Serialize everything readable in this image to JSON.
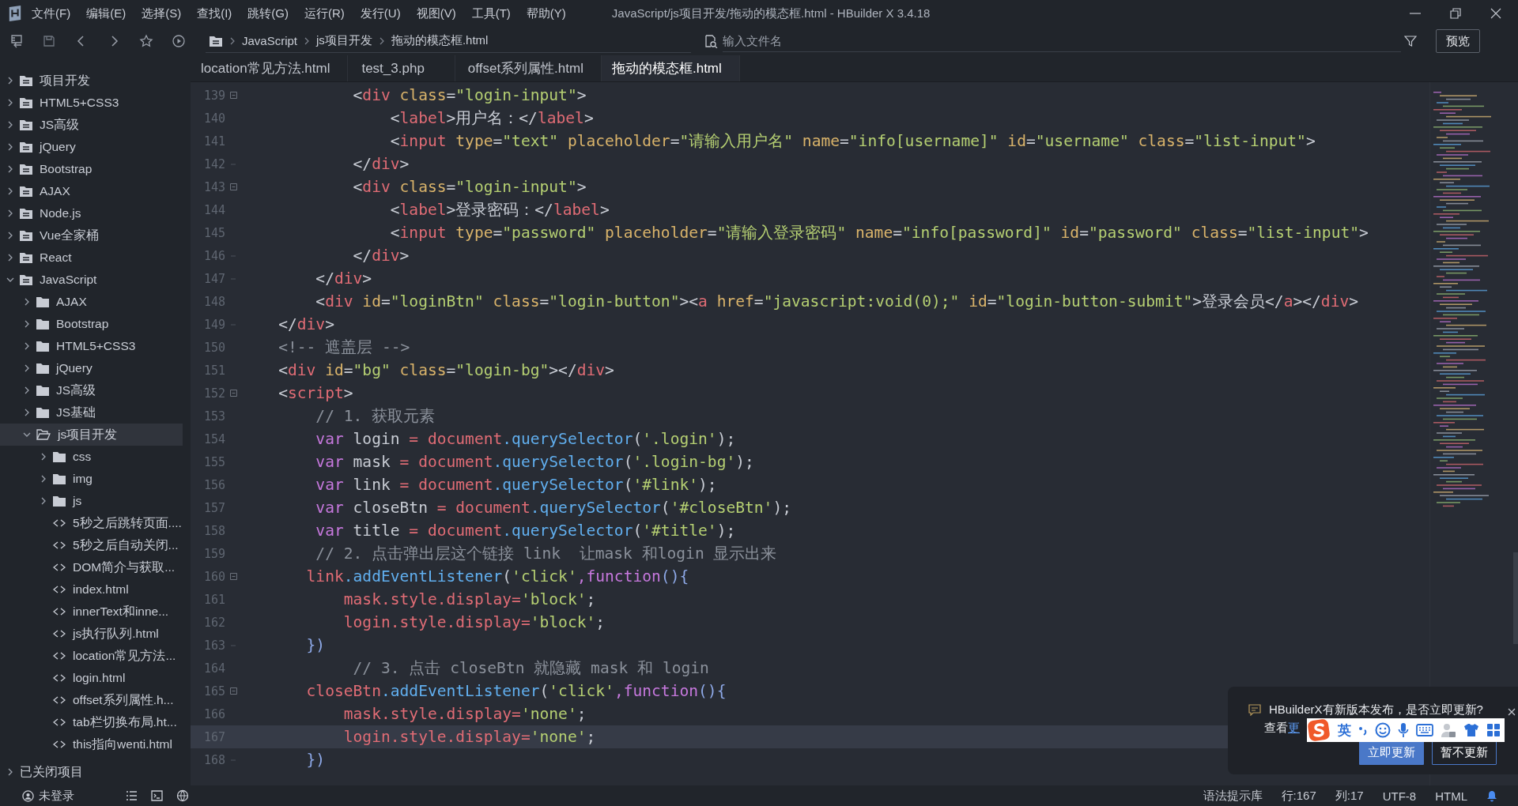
{
  "window": {
    "title": "JavaScript/js项目开发/拖动的模态框.html - HBuilder X 3.4.18"
  },
  "menu": [
    "文件(F)",
    "编辑(E)",
    "选择(S)",
    "查找(I)",
    "跳转(G)",
    "运行(R)",
    "发行(U)",
    "视图(V)",
    "工具(T)",
    "帮助(Y)"
  ],
  "toolbar": {
    "breadcrumb": [
      "JavaScript",
      "js项目开发",
      "拖动的模态框.html"
    ],
    "file_search": {
      "placeholder": "输入文件名"
    },
    "preview_button": "预览"
  },
  "tabs": [
    {
      "label": "location常见方法.html",
      "selected": false
    },
    {
      "label": "test_3.php",
      "selected": false
    },
    {
      "label": "offset系列属性.html",
      "selected": false
    },
    {
      "label": "拖动的模态框.html",
      "selected": true
    }
  ],
  "sidebar": {
    "items": [
      {
        "label": "项目开发",
        "kind": "project",
        "expanded": false,
        "selected": false
      },
      {
        "label": "HTML5+CSS3",
        "kind": "project",
        "expanded": false,
        "selected": false
      },
      {
        "label": "JS高级",
        "kind": "project",
        "expanded": false,
        "selected": false
      },
      {
        "label": "jQuery",
        "kind": "project",
        "expanded": false,
        "selected": false
      },
      {
        "label": "Bootstrap",
        "kind": "project",
        "expanded": false,
        "selected": false
      },
      {
        "label": "AJAX",
        "kind": "project",
        "expanded": false,
        "selected": false
      },
      {
        "label": "Node.js",
        "kind": "project",
        "expanded": false,
        "selected": false
      },
      {
        "label": "Vue全家桶",
        "kind": "project",
        "expanded": false,
        "selected": false
      },
      {
        "label": "React",
        "kind": "project",
        "expanded": false,
        "selected": false
      },
      {
        "label": "JavaScript",
        "kind": "project",
        "expanded": true,
        "selected": false,
        "children": [
          {
            "label": "AJAX",
            "kind": "folder",
            "expanded": false,
            "selected": false
          },
          {
            "label": "Bootstrap",
            "kind": "folder",
            "expanded": false,
            "selected": false
          },
          {
            "label": "HTML5+CSS3",
            "kind": "folder",
            "expanded": false,
            "selected": false
          },
          {
            "label": "jQuery",
            "kind": "folder",
            "expanded": false,
            "selected": false
          },
          {
            "label": "JS高级",
            "kind": "folder",
            "expanded": false,
            "selected": false
          },
          {
            "label": "JS基础",
            "kind": "folder",
            "expanded": false,
            "selected": false
          },
          {
            "label": "js项目开发",
            "kind": "folder",
            "expanded": true,
            "selected": true,
            "children": [
              {
                "label": "css",
                "kind": "folder",
                "expanded": false,
                "selected": false
              },
              {
                "label": "img",
                "kind": "folder",
                "expanded": false,
                "selected": false
              },
              {
                "label": "js",
                "kind": "folder",
                "expanded": false,
                "selected": false
              },
              {
                "label": "5秒之后跳转页面....",
                "kind": "file",
                "selected": false
              },
              {
                "label": "5秒之后自动关闭...",
                "kind": "file",
                "selected": false
              },
              {
                "label": "DOM简介与获取...",
                "kind": "file",
                "selected": false
              },
              {
                "label": "index.html",
                "kind": "file",
                "selected": false
              },
              {
                "label": "innerText和inne...",
                "kind": "file",
                "selected": false
              },
              {
                "label": "js执行队列.html",
                "kind": "file",
                "selected": false
              },
              {
                "label": "location常见方法...",
                "kind": "file",
                "selected": false
              },
              {
                "label": "login.html",
                "kind": "file",
                "selected": false
              },
              {
                "label": "offset系列属性.h...",
                "kind": "file",
                "selected": false
              },
              {
                "label": "tab栏切换布局.ht...",
                "kind": "file",
                "selected": false
              },
              {
                "label": "this指向wenti.html",
                "kind": "file",
                "selected": false
              }
            ]
          }
        ]
      }
    ],
    "closed_projects": {
      "label": "已关闭项目",
      "expanded": false
    }
  },
  "editor": {
    "lines": [
      {
        "number": "139",
        "fold_start": true,
        "fold_end": false,
        "current": false,
        "tokens": [
          {
            "kind": "plain",
            "text": "            <"
          },
          {
            "kind": "tag",
            "text": "div"
          },
          {
            "kind": "attr",
            "text": " class"
          },
          {
            "kind": "plain",
            "text": "="
          },
          {
            "kind": "str",
            "text": "\"login-input\""
          },
          {
            "kind": "plain",
            "text": ">"
          }
        ]
      },
      {
        "number": "140",
        "fold_start": false,
        "fold_end": false,
        "current": false,
        "tokens": [
          {
            "kind": "plain",
            "text": "                <"
          },
          {
            "kind": "tag",
            "text": "label"
          },
          {
            "kind": "plain",
            "text": ">用户名：</"
          },
          {
            "kind": "tag",
            "text": "label"
          },
          {
            "kind": "plain",
            "text": ">"
          }
        ]
      },
      {
        "number": "141",
        "fold_start": false,
        "fold_end": false,
        "current": false,
        "tokens": [
          {
            "kind": "plain",
            "text": "                <"
          },
          {
            "kind": "tag",
            "text": "input"
          },
          {
            "kind": "attr",
            "text": " type"
          },
          {
            "kind": "plain",
            "text": "="
          },
          {
            "kind": "str",
            "text": "\"text\""
          },
          {
            "kind": "attr",
            "text": " placeholder"
          },
          {
            "kind": "plain",
            "text": "="
          },
          {
            "kind": "str",
            "text": "\"请输入用户名\""
          },
          {
            "kind": "attr",
            "text": " name"
          },
          {
            "kind": "plain",
            "text": "="
          },
          {
            "kind": "str",
            "text": "\"info[username]\""
          },
          {
            "kind": "attr",
            "text": " id"
          },
          {
            "kind": "plain",
            "text": "="
          },
          {
            "kind": "str",
            "text": "\"username\""
          },
          {
            "kind": "attr",
            "text": " class"
          },
          {
            "kind": "plain",
            "text": "="
          },
          {
            "kind": "str",
            "text": "\"list-input\""
          },
          {
            "kind": "plain",
            "text": ">"
          }
        ]
      },
      {
        "number": "142",
        "fold_start": false,
        "fold_end": true,
        "current": false,
        "tokens": [
          {
            "kind": "plain",
            "text": "            </"
          },
          {
            "kind": "tag",
            "text": "div"
          },
          {
            "kind": "plain",
            "text": ">"
          }
        ]
      },
      {
        "number": "143",
        "fold_start": true,
        "fold_end": false,
        "current": false,
        "tokens": [
          {
            "kind": "plain",
            "text": "            <"
          },
          {
            "kind": "tag",
            "text": "div"
          },
          {
            "kind": "attr",
            "text": " class"
          },
          {
            "kind": "plain",
            "text": "="
          },
          {
            "kind": "str",
            "text": "\"login-input\""
          },
          {
            "kind": "plain",
            "text": ">"
          }
        ]
      },
      {
        "number": "144",
        "fold_start": false,
        "fold_end": false,
        "current": false,
        "tokens": [
          {
            "kind": "plain",
            "text": "                <"
          },
          {
            "kind": "tag",
            "text": "label"
          },
          {
            "kind": "plain",
            "text": ">登录密码：</"
          },
          {
            "kind": "tag",
            "text": "label"
          },
          {
            "kind": "plain",
            "text": ">"
          }
        ]
      },
      {
        "number": "145",
        "fold_start": false,
        "fold_end": false,
        "current": false,
        "tokens": [
          {
            "kind": "plain",
            "text": "                <"
          },
          {
            "kind": "tag",
            "text": "input"
          },
          {
            "kind": "attr",
            "text": " type"
          },
          {
            "kind": "plain",
            "text": "="
          },
          {
            "kind": "str",
            "text": "\"password\""
          },
          {
            "kind": "attr",
            "text": " placeholder"
          },
          {
            "kind": "plain",
            "text": "="
          },
          {
            "kind": "str",
            "text": "\"请输入登录密码\""
          },
          {
            "kind": "attr",
            "text": " name"
          },
          {
            "kind": "plain",
            "text": "="
          },
          {
            "kind": "str",
            "text": "\"info[password]\""
          },
          {
            "kind": "attr",
            "text": " id"
          },
          {
            "kind": "plain",
            "text": "="
          },
          {
            "kind": "str",
            "text": "\"password\""
          },
          {
            "kind": "attr",
            "text": " class"
          },
          {
            "kind": "plain",
            "text": "="
          },
          {
            "kind": "str",
            "text": "\"list-input\""
          },
          {
            "kind": "plain",
            "text": ">"
          }
        ]
      },
      {
        "number": "146",
        "fold_start": false,
        "fold_end": true,
        "current": false,
        "tokens": [
          {
            "kind": "plain",
            "text": "            </"
          },
          {
            "kind": "tag",
            "text": "div"
          },
          {
            "kind": "plain",
            "text": ">"
          }
        ]
      },
      {
        "number": "147",
        "fold_start": false,
        "fold_end": true,
        "current": false,
        "tokens": [
          {
            "kind": "plain",
            "text": "        </"
          },
          {
            "kind": "tag",
            "text": "div"
          },
          {
            "kind": "plain",
            "text": ">"
          }
        ]
      },
      {
        "number": "148",
        "fold_start": false,
        "fold_end": false,
        "current": false,
        "tokens": [
          {
            "kind": "plain",
            "text": "        <"
          },
          {
            "kind": "tag",
            "text": "div"
          },
          {
            "kind": "attr",
            "text": " id"
          },
          {
            "kind": "plain",
            "text": "="
          },
          {
            "kind": "str",
            "text": "\"loginBtn\""
          },
          {
            "kind": "attr",
            "text": " class"
          },
          {
            "kind": "plain",
            "text": "="
          },
          {
            "kind": "str",
            "text": "\"login-button\""
          },
          {
            "kind": "plain",
            "text": "><"
          },
          {
            "kind": "tag",
            "text": "a"
          },
          {
            "kind": "attr",
            "text": " href"
          },
          {
            "kind": "plain",
            "text": "="
          },
          {
            "kind": "str",
            "text": "\"javascript:void(0);\""
          },
          {
            "kind": "attr",
            "text": " id"
          },
          {
            "kind": "plain",
            "text": "="
          },
          {
            "kind": "str",
            "text": "\"login-button-submit\""
          },
          {
            "kind": "plain",
            "text": ">登录会员</"
          },
          {
            "kind": "tag",
            "text": "a"
          },
          {
            "kind": "plain",
            "text": "></"
          },
          {
            "kind": "tag",
            "text": "div"
          },
          {
            "kind": "plain",
            "text": ">"
          }
        ]
      },
      {
        "number": "149",
        "fold_start": false,
        "fold_end": true,
        "current": false,
        "tokens": [
          {
            "kind": "plain",
            "text": "    </"
          },
          {
            "kind": "tag",
            "text": "div"
          },
          {
            "kind": "plain",
            "text": ">"
          }
        ]
      },
      {
        "number": "150",
        "fold_start": false,
        "fold_end": false,
        "current": false,
        "tokens": [
          {
            "kind": "comment",
            "text": "    <!-- 遮盖层 -->"
          }
        ]
      },
      {
        "number": "151",
        "fold_start": false,
        "fold_end": false,
        "current": false,
        "tokens": [
          {
            "kind": "plain",
            "text": "    <"
          },
          {
            "kind": "tag",
            "text": "div"
          },
          {
            "kind": "attr",
            "text": " id"
          },
          {
            "kind": "plain",
            "text": "="
          },
          {
            "kind": "str",
            "text": "\"bg\""
          },
          {
            "kind": "attr",
            "text": " class"
          },
          {
            "kind": "plain",
            "text": "="
          },
          {
            "kind": "str",
            "text": "\"login-bg\""
          },
          {
            "kind": "plain",
            "text": "></"
          },
          {
            "kind": "tag",
            "text": "div"
          },
          {
            "kind": "plain",
            "text": ">"
          }
        ]
      },
      {
        "number": "152",
        "fold_start": true,
        "fold_end": false,
        "current": false,
        "tokens": [
          {
            "kind": "plain",
            "text": "    <"
          },
          {
            "kind": "tag",
            "text": "script"
          },
          {
            "kind": "plain",
            "text": ">"
          }
        ]
      },
      {
        "number": "153",
        "fold_start": false,
        "fold_end": false,
        "current": false,
        "tokens": [
          {
            "kind": "comment",
            "text": "        // 1. 获取元素"
          }
        ]
      },
      {
        "number": "154",
        "fold_start": false,
        "fold_end": false,
        "current": false,
        "tokens": [
          {
            "kind": "kw",
            "text": "        var"
          },
          {
            "kind": "plain",
            "text": " login "
          },
          {
            "kind": "op",
            "text": "="
          },
          {
            "kind": "obj",
            "text": " document"
          },
          {
            "kind": "fn",
            "text": ".querySelector"
          },
          {
            "kind": "plain",
            "text": "("
          },
          {
            "kind": "str",
            "text": "'.login'"
          },
          {
            "kind": "plain",
            "text": ");"
          }
        ]
      },
      {
        "number": "155",
        "fold_start": false,
        "fold_end": false,
        "current": false,
        "tokens": [
          {
            "kind": "kw",
            "text": "        var"
          },
          {
            "kind": "plain",
            "text": " mask "
          },
          {
            "kind": "op",
            "text": "="
          },
          {
            "kind": "obj",
            "text": " document"
          },
          {
            "kind": "fn",
            "text": ".querySelector"
          },
          {
            "kind": "plain",
            "text": "("
          },
          {
            "kind": "str",
            "text": "'.login-bg'"
          },
          {
            "kind": "plain",
            "text": ");"
          }
        ]
      },
      {
        "number": "156",
        "fold_start": false,
        "fold_end": false,
        "current": false,
        "tokens": [
          {
            "kind": "kw",
            "text": "        var"
          },
          {
            "kind": "plain",
            "text": " link "
          },
          {
            "kind": "op",
            "text": "="
          },
          {
            "kind": "obj",
            "text": " document"
          },
          {
            "kind": "fn",
            "text": ".querySelector"
          },
          {
            "kind": "plain",
            "text": "("
          },
          {
            "kind": "str",
            "text": "'#link'"
          },
          {
            "kind": "plain",
            "text": ");"
          }
        ]
      },
      {
        "number": "157",
        "fold_start": false,
        "fold_end": false,
        "current": false,
        "tokens": [
          {
            "kind": "kw",
            "text": "        var"
          },
          {
            "kind": "plain",
            "text": " closeBtn "
          },
          {
            "kind": "op",
            "text": "="
          },
          {
            "kind": "obj",
            "text": " document"
          },
          {
            "kind": "fn",
            "text": ".querySelector"
          },
          {
            "kind": "plain",
            "text": "("
          },
          {
            "kind": "str",
            "text": "'#closeBtn'"
          },
          {
            "kind": "plain",
            "text": ");"
          }
        ]
      },
      {
        "number": "158",
        "fold_start": false,
        "fold_end": false,
        "current": false,
        "tokens": [
          {
            "kind": "kw",
            "text": "        var"
          },
          {
            "kind": "plain",
            "text": " title "
          },
          {
            "kind": "op",
            "text": "="
          },
          {
            "kind": "obj",
            "text": " document"
          },
          {
            "kind": "fn",
            "text": ".querySelector"
          },
          {
            "kind": "plain",
            "text": "("
          },
          {
            "kind": "str",
            "text": "'#title'"
          },
          {
            "kind": "plain",
            "text": ");"
          }
        ]
      },
      {
        "number": "159",
        "fold_start": false,
        "fold_end": false,
        "current": false,
        "tokens": [
          {
            "kind": "comment",
            "text": "        // 2. 点击弹出层这个链接 link  让mask 和login 显示出来"
          }
        ]
      },
      {
        "number": "160",
        "fold_start": true,
        "fold_end": false,
        "current": false,
        "tokens": [
          {
            "kind": "obj",
            "text": "       link"
          },
          {
            "kind": "fn",
            "text": ".addEventListener"
          },
          {
            "kind": "plain",
            "text": "("
          },
          {
            "kind": "str",
            "text": "'click'"
          },
          {
            "kind": "kw",
            "text": ",function"
          },
          {
            "kind": "brace",
            "text": "(){"
          }
        ]
      },
      {
        "number": "161",
        "fold_start": false,
        "fold_end": false,
        "current": false,
        "tokens": [
          {
            "kind": "obj",
            "text": "           mask.style.display"
          },
          {
            "kind": "op",
            "text": "="
          },
          {
            "kind": "str",
            "text": "'block'"
          },
          {
            "kind": "plain",
            "text": ";"
          }
        ]
      },
      {
        "number": "162",
        "fold_start": false,
        "fold_end": false,
        "current": false,
        "tokens": [
          {
            "kind": "obj",
            "text": "           login.style.display"
          },
          {
            "kind": "op",
            "text": "="
          },
          {
            "kind": "str",
            "text": "'block'"
          },
          {
            "kind": "plain",
            "text": ";"
          }
        ]
      },
      {
        "number": "163",
        "fold_start": false,
        "fold_end": true,
        "current": false,
        "tokens": [
          {
            "kind": "brace",
            "text": "       })"
          }
        ]
      },
      {
        "number": "164",
        "fold_start": false,
        "fold_end": false,
        "current": false,
        "tokens": [
          {
            "kind": "comment",
            "text": "            // 3. 点击 closeBtn 就隐藏 mask 和 login"
          }
        ]
      },
      {
        "number": "165",
        "fold_start": true,
        "fold_end": false,
        "current": false,
        "tokens": [
          {
            "kind": "obj",
            "text": "       closeBtn"
          },
          {
            "kind": "fn",
            "text": ".addEventListener"
          },
          {
            "kind": "plain",
            "text": "("
          },
          {
            "kind": "str",
            "text": "'click'"
          },
          {
            "kind": "kw",
            "text": ",function"
          },
          {
            "kind": "brace",
            "text": "(){"
          }
        ]
      },
      {
        "number": "166",
        "fold_start": false,
        "fold_end": false,
        "current": false,
        "tokens": [
          {
            "kind": "obj",
            "text": "           mask.style.display"
          },
          {
            "kind": "op",
            "text": "="
          },
          {
            "kind": "str",
            "text": "'none'"
          },
          {
            "kind": "plain",
            "text": ";"
          }
        ]
      },
      {
        "number": "167",
        "fold_start": false,
        "fold_end": false,
        "current": true,
        "tokens": [
          {
            "kind": "obj",
            "text": "           login.style.display"
          },
          {
            "kind": "op",
            "text": "="
          },
          {
            "kind": "str",
            "text": "'none'"
          },
          {
            "kind": "plain",
            "text": ";"
          }
        ]
      },
      {
        "number": "168",
        "fold_start": false,
        "fold_end": true,
        "current": false,
        "tokens": [
          {
            "kind": "brace",
            "text": "       })"
          }
        ]
      }
    ]
  },
  "notification": {
    "message": "HBuilderX有新版本发布，是否立即更新?",
    "prefix": "查看",
    "link": "更",
    "buttons": [
      {
        "label": "立即更新",
        "kind": "primary"
      },
      {
        "label": "暂不更新",
        "kind": "secondary"
      }
    ]
  },
  "ime_toolbar": {
    "mode": "英"
  },
  "status_bar": {
    "user": "未登录",
    "syntax": "语法提示库",
    "line": "行:167",
    "column": "列:17",
    "encoding": "UTF-8",
    "language": "HTML"
  }
}
